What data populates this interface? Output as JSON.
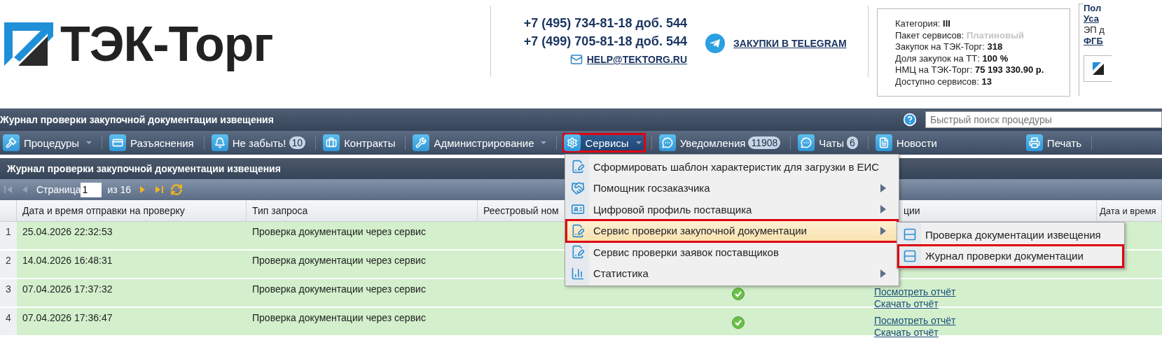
{
  "header": {
    "logo": "ТЭК-Торг",
    "phones": [
      "+7 (495) 734-81-18 доб. 544",
      "+7 (499) 705-81-18 доб. 544"
    ],
    "email": "HELP@TEKTORG.RU",
    "telegram": "ЗАКУПКИ В TELEGRAM",
    "info": [
      {
        "label": "Категория:",
        "value": "III",
        "muted": false
      },
      {
        "label": "Пакет сервисов:",
        "value": "Платиновый",
        "muted": true
      },
      {
        "label": "Закупок на ТЭК-Торг:",
        "value": "318",
        "muted": false
      },
      {
        "label": "Доля закупок на ТТ:",
        "value": "100 %",
        "muted": false
      },
      {
        "label": "НМЦ на ТЭК-Торг:",
        "value": "75 193 330.90 р.",
        "muted": false
      },
      {
        "label": "Доступно сервисов:",
        "value": "13",
        "muted": false
      }
    ],
    "side_panel": {
      "title": "Пол",
      "lines": [
        {
          "text": "Уса",
          "kind": "link"
        },
        {
          "text": "ЭП д",
          "kind": "plain"
        },
        {
          "text": "ФГБ",
          "kind": "link"
        }
      ]
    }
  },
  "title_bar": {
    "title": "Журнал проверки закупочной документации извещения",
    "search": {
      "placeholder": "Быстрый поиск процедуры"
    }
  },
  "toolbar": [
    {
      "label": "Процедуры",
      "dropdown": true,
      "selected": false,
      "annotated": false
    },
    {
      "label": "Разъяснения",
      "dropdown": false,
      "selected": false,
      "annotated": false
    },
    {
      "label": "Не забыть!",
      "badge": "10",
      "dropdown": false,
      "selected": false,
      "annotated": false
    },
    {
      "label": "Контракты",
      "dropdown": false,
      "selected": false,
      "annotated": false
    },
    {
      "label": "Администрирование",
      "dropdown": true,
      "selected": false,
      "annotated": false
    },
    {
      "label": "Сервисы",
      "dropdown": true,
      "selected": true,
      "annotated": true
    },
    {
      "label": "Уведомления",
      "badge": "11908",
      "dropdown": false,
      "selected": false,
      "annotated": false
    },
    {
      "label": "Чаты",
      "badge": "6",
      "dropdown": false,
      "selected": false,
      "annotated": false
    },
    {
      "label": "Новости",
      "dropdown": false,
      "selected": false,
      "annotated": false
    }
  ],
  "print": "Печать",
  "panel": {
    "title": "Журнал проверки закупочной документации извещения",
    "pager": {
      "buttons": [
        {
          "disabled": true
        },
        {
          "disabled": true
        },
        {
          "disabled": false
        },
        {
          "disabled": false
        }
      ],
      "page_label": "Страница",
      "page": "1",
      "total": "из 16"
    },
    "table": {
      "columns": [
        "Дата и время отправки на проверку",
        "Тип запроса",
        "Реестровый ном",
        "ции",
        "Дата и время"
      ],
      "rows": [
        {
          "num": "1",
          "date": "25.04.2026 22:32:53",
          "type": "Проверка документации через сервис"
        },
        {
          "num": "2",
          "date": "14.04.2026 16:48:31",
          "type": "Проверка документации через сервис"
        },
        {
          "num": "3",
          "date": "07.04.2026 17:37:32",
          "type": "Проверка документации через сервис",
          "verified": true,
          "links": [
            "Посмотреть отчёт",
            "Скачать отчёт"
          ]
        },
        {
          "num": "4",
          "date": "07.04.2026 17:36:47",
          "type": "Проверка документации через сервис",
          "verified": true,
          "links": [
            "Посмотреть отчёт",
            "Скачать отчёт"
          ]
        }
      ]
    }
  },
  "menu": {
    "items": [
      {
        "label": "Сформировать шаблон характеристик для загрузки в ЕИС",
        "submenu": false,
        "selected": false,
        "annotated": false
      },
      {
        "label": "Помощник госзаказчика",
        "submenu": true,
        "selected": false,
        "annotated": false
      },
      {
        "label": "Цифровой профиль поставщика",
        "submenu": true,
        "selected": false,
        "annotated": false
      },
      {
        "label": "Сервис проверки закупочной документации",
        "submenu": true,
        "selected": true,
        "annotated": true
      },
      {
        "label": "Сервис проверки заявок поставщиков",
        "submenu": false,
        "selected": false,
        "annotated": false
      },
      {
        "label": "Статистика",
        "submenu": true,
        "selected": false,
        "annotated": false
      }
    ],
    "submenu": [
      {
        "label": "Проверка документации извещения",
        "selected": false,
        "annotated": false
      },
      {
        "label": "Журнал проверки документации",
        "selected": false,
        "annotated": true
      }
    ]
  }
}
